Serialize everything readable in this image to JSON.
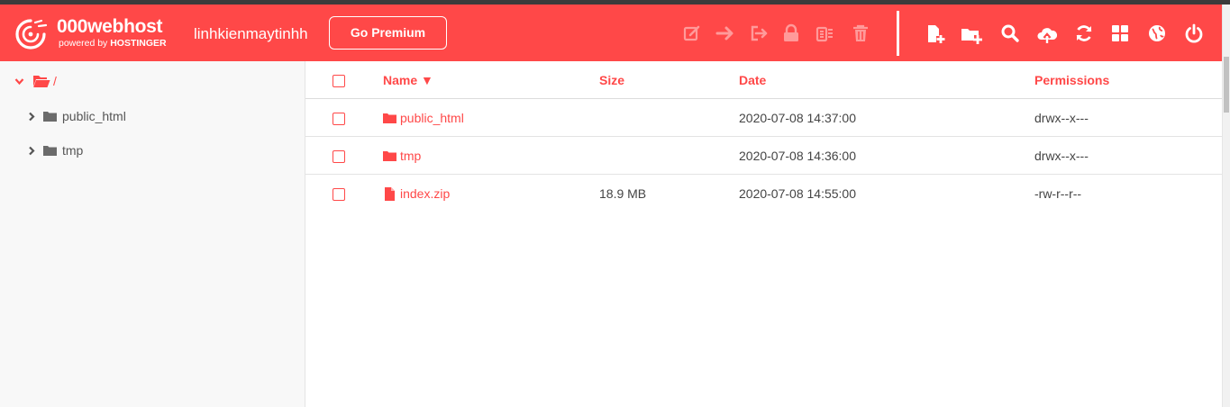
{
  "header": {
    "brand": "000webhost",
    "tagline_prefix": "powered by ",
    "tagline_brand": "HOSTINGER",
    "site_name": "linhkienmaytinhh",
    "premium_label": "Go Premium",
    "accent_color": "#ff4848"
  },
  "toolbar": {
    "disabled_actions": [
      "edit-icon",
      "move-icon",
      "rename-icon",
      "lock-icon",
      "archive-icon",
      "trash-icon"
    ],
    "actions": [
      "new-file-icon",
      "new-folder-icon",
      "search-icon",
      "upload-icon",
      "refresh-icon",
      "grid-view-icon",
      "globe-icon",
      "power-icon"
    ]
  },
  "sidebar": {
    "root_label": "/",
    "items": [
      {
        "label": "public_html"
      },
      {
        "label": "tmp"
      }
    ]
  },
  "table": {
    "columns": {
      "name": "Name ▼",
      "size": "Size",
      "date": "Date",
      "permissions": "Permissions"
    },
    "rows": [
      {
        "type": "folder",
        "name": "public_html",
        "size": "",
        "date": "2020-07-08 14:37:00",
        "permissions": "drwx--x---"
      },
      {
        "type": "folder",
        "name": "tmp",
        "size": "",
        "date": "2020-07-08 14:36:00",
        "permissions": "drwx--x---"
      },
      {
        "type": "file",
        "name": "index.zip",
        "size": "18.9 MB",
        "date": "2020-07-08 14:55:00",
        "permissions": "-rw-r--r--"
      }
    ]
  }
}
